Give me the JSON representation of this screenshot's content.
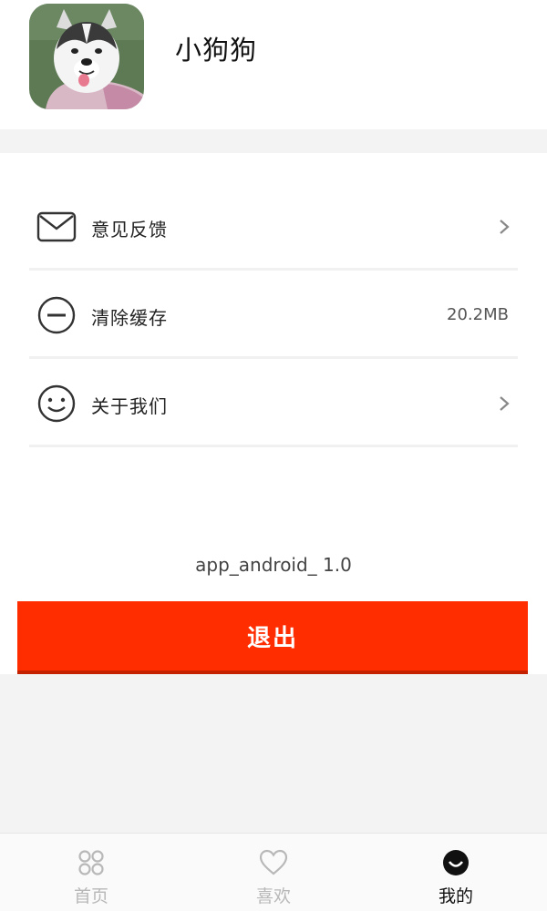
{
  "profile": {
    "username": "小狗狗",
    "avatar_icon": "husky-avatar-photo"
  },
  "menu": {
    "items": [
      {
        "icon": "envelope-icon",
        "label": "意见反馈",
        "trailing": "chevron-right-icon"
      },
      {
        "icon": "minus-circle-icon",
        "label": "清除缓存",
        "value": "20.2MB"
      },
      {
        "icon": "smiley-icon",
        "label": "关于我们",
        "trailing": "chevron-right-icon"
      }
    ]
  },
  "version": "app_android_ 1.0",
  "logout_label": "退出",
  "colors": {
    "accent": "#ff2d00",
    "tab_inactive": "#b8b8b8",
    "tab_active": "#111111",
    "divider": "#f1f1f1"
  },
  "tabs": [
    {
      "label": "首页",
      "icon": "grid-icon",
      "active": false
    },
    {
      "label": "喜欢",
      "icon": "heart-icon",
      "active": false
    },
    {
      "label": "我的",
      "icon": "smile-face-icon",
      "active": true
    }
  ]
}
